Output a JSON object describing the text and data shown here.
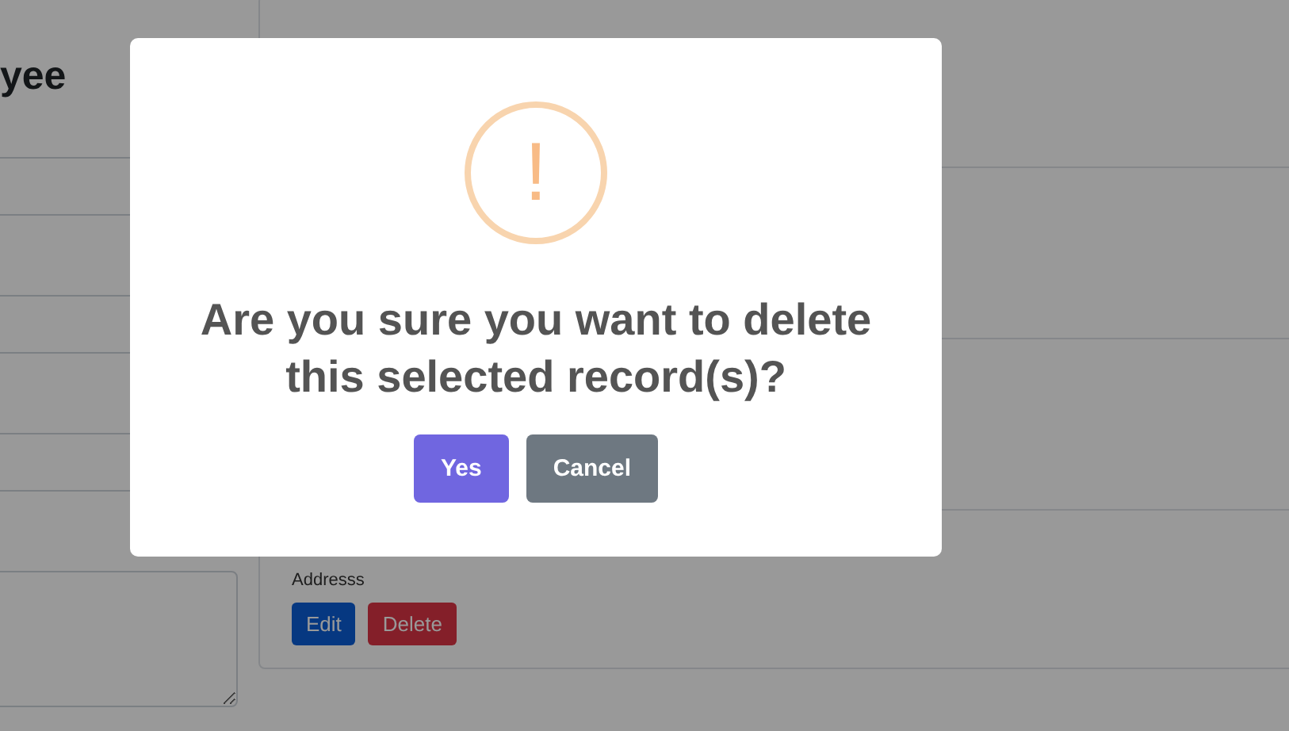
{
  "page": {
    "heading": "yee",
    "form_fields": [
      {
        "kind": "input"
      },
      {
        "kind": "input"
      },
      {
        "kind": "input"
      },
      {
        "kind": "textarea"
      }
    ],
    "records": [
      {
        "address": "Addresss",
        "actions": [
          "Edit",
          "Delete"
        ]
      }
    ]
  },
  "dialog": {
    "icon": "!",
    "message": "Are you sure you want to delete this selected record(s)?",
    "buttons": [
      {
        "label": "Yes",
        "kind": "confirm"
      },
      {
        "label": "Cancel",
        "kind": "cancel"
      }
    ]
  }
}
